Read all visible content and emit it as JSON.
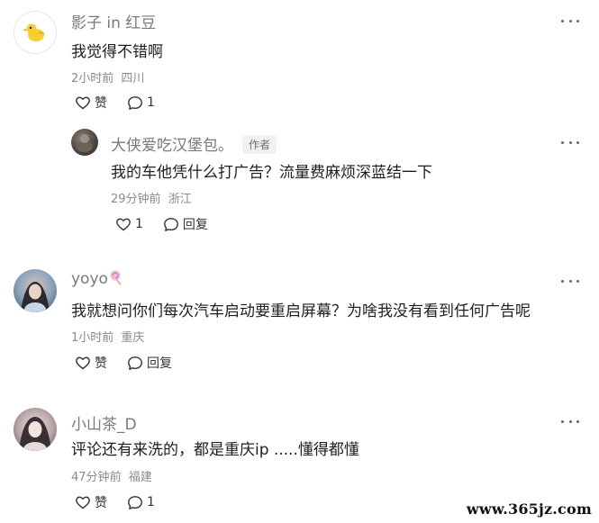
{
  "comments": [
    {
      "author": "影子 in 红豆",
      "text": "我觉得不错啊",
      "time": "2小时前",
      "location": "四川",
      "like_label": "赞",
      "reply_count": "1",
      "avatar_icon": "yellow-duck-avatar"
    },
    {
      "author": "大侠爱吃汉堡包。",
      "tag": "作者",
      "text": "我的车他凭什么打广告？流量费麻烦深蓝结一下",
      "time": "29分钟前",
      "location": "浙江",
      "like_count": "1",
      "reply_label": "回复",
      "avatar_icon": "photo-avatar"
    },
    {
      "author": "yoyo",
      "text": "我就想问你们每次汽车启动要重启屏幕？为啥我没有看到任何广告呢",
      "time": "1小时前",
      "location": "重庆",
      "like_label": "赞",
      "reply_label": "回复",
      "avatar_icon": "photo-avatar",
      "author_emoji": "lollipop-emoji"
    },
    {
      "author": "小山茶_D",
      "text": "评论还有来洗的，都是重庆ip .....懂得都懂",
      "time": "47分钟前",
      "location": "福建",
      "like_label": "赞",
      "reply_count": "1",
      "avatar_icon": "photo-avatar"
    }
  ],
  "watermark": "www.365jz.com"
}
